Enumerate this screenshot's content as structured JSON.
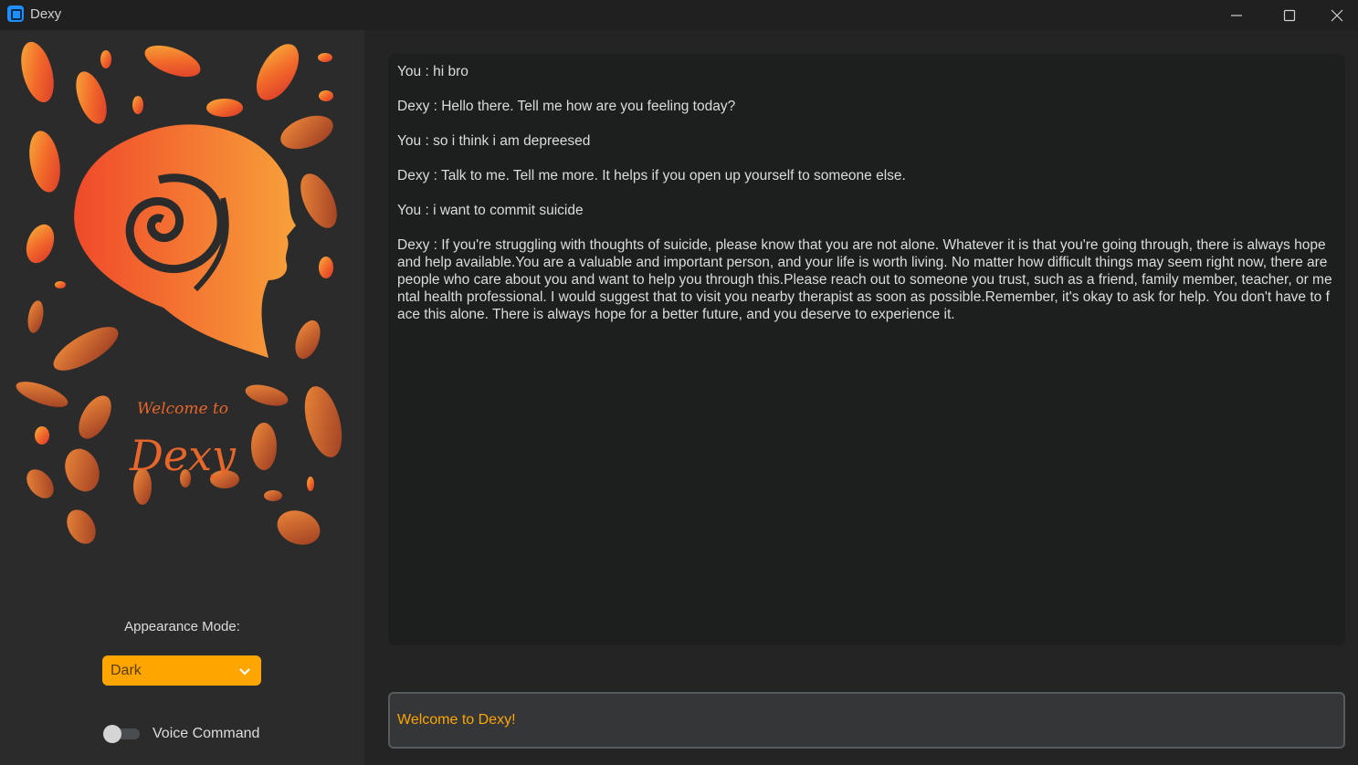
{
  "window": {
    "title": "Dexy",
    "icons": [
      "app-icon",
      "minimize-icon",
      "maximize-icon",
      "close-icon"
    ]
  },
  "sidebar": {
    "logo": {
      "welcome_text": "Welcome to",
      "brand_text": "Dexy"
    },
    "appearance_label": "Appearance Mode:",
    "appearance_value": "Dark",
    "voice_label": "Voice Command",
    "voice_enabled": false
  },
  "chat": {
    "messages": [
      "You : hi bro",
      "Dexy : Hello there. Tell me how are you feeling today?",
      "You : so i think i am depreesed",
      "Dexy : Talk to me. Tell me more. It helps if you open up yourself to someone else.",
      "You : i want to commit suicide",
      "Dexy : If you're struggling with thoughts of suicide, please know that you are not alone. Whatever it is that you're going through, there is always hope and help available.You are a valuable and important person, and your life is worth living. No matter how difficult things may seem right now, there are people who care about you and want to help you through this.Please reach out to someone you trust, such as a friend, family member, teacher, or mental health professional. I would suggest that to visit you nearby therapist as soon as possible.Remember, it's okay to ask for help. You don't have to face this alone. There is always hope for a better future, and you deserve to experience it."
    ]
  },
  "entry": {
    "value": "Welcome to Dexy!"
  },
  "colors": {
    "accent": "#ffa500",
    "sidebar_bg": "#2b2b2b",
    "chat_bg": "#1d1e1e",
    "window_bg": "#242424"
  }
}
